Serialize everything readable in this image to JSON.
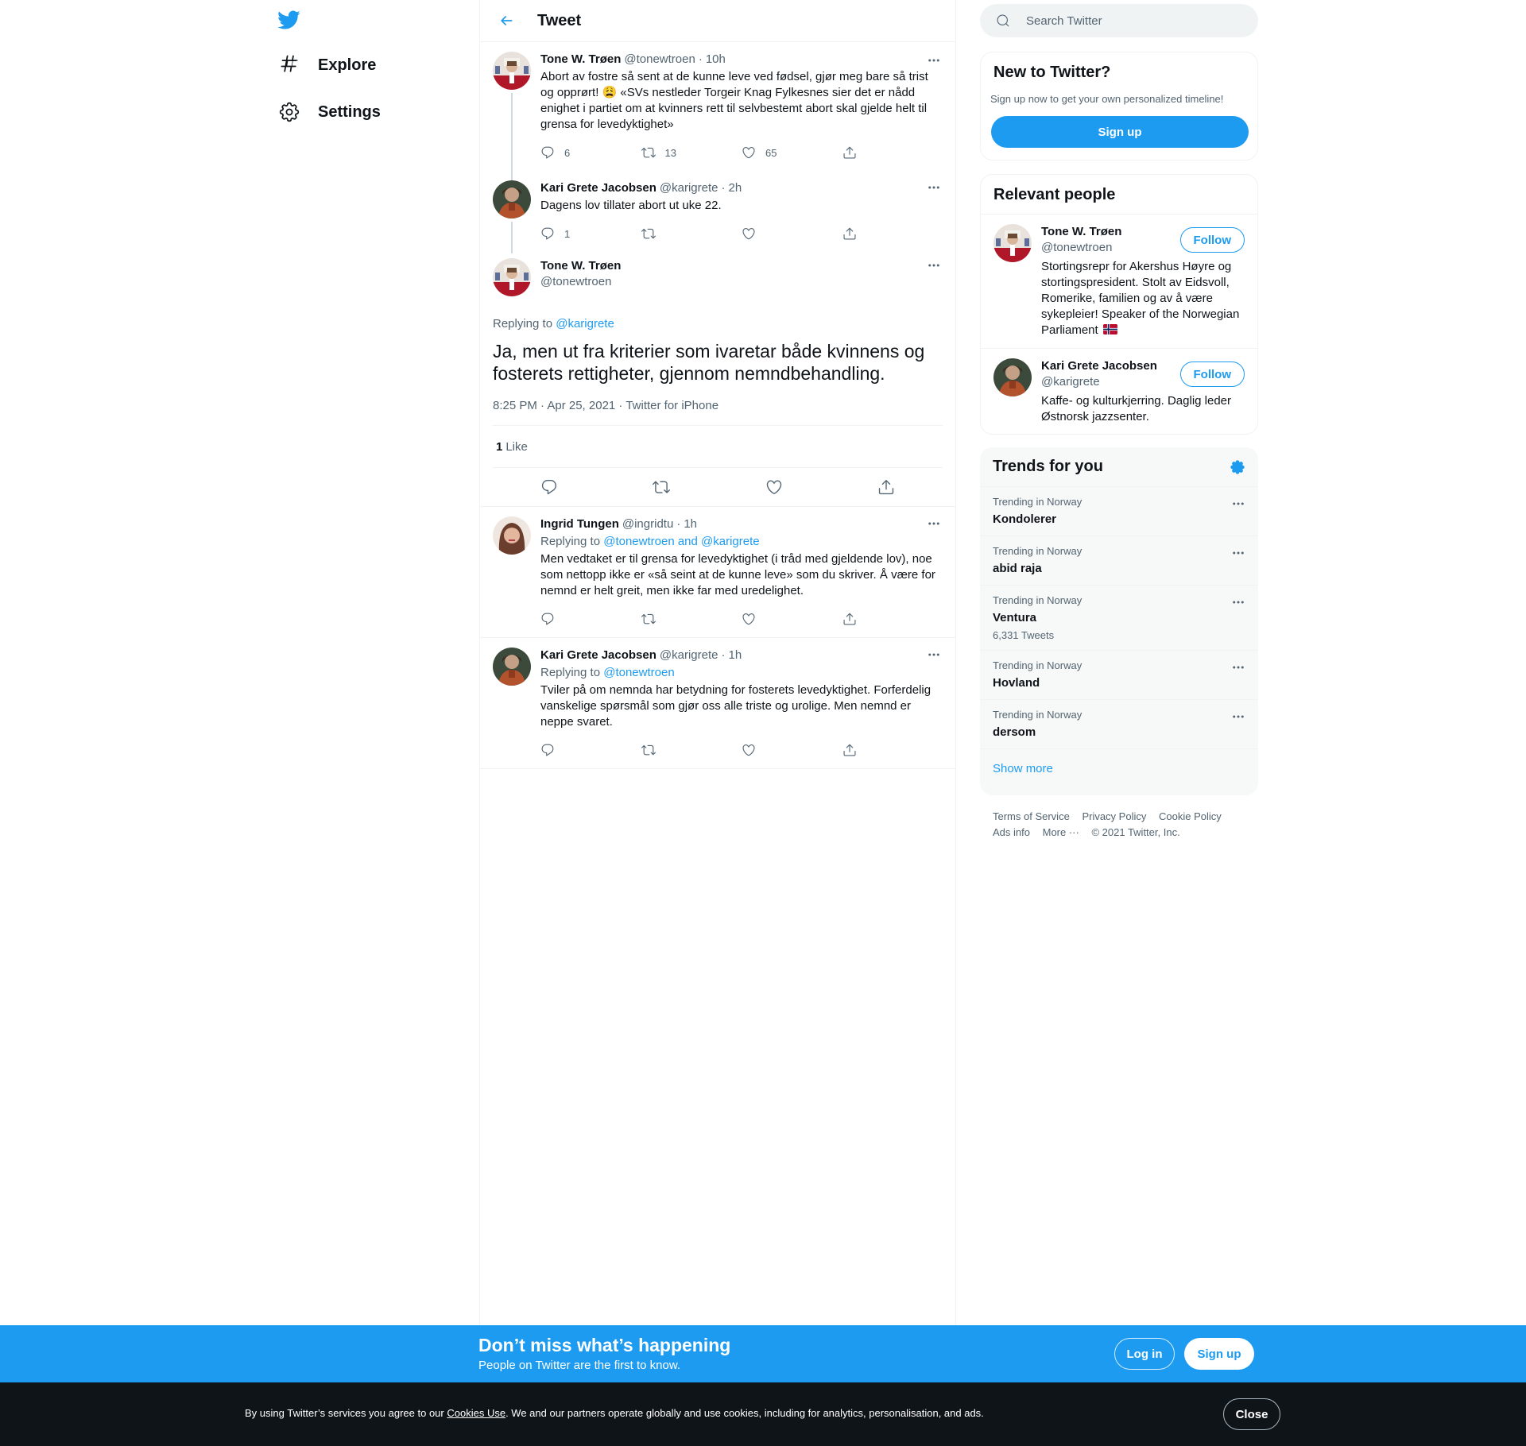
{
  "nav": {
    "items": [
      {
        "label": "Explore",
        "icon": "hashtag-icon"
      },
      {
        "label": "Settings",
        "icon": "gear-icon"
      }
    ]
  },
  "header": {
    "title": "Tweet"
  },
  "thread": [
    {
      "name": "Tone W. Trøen",
      "handle": "@tonewtroen",
      "time": "10h",
      "text": "Abort av fostre så sent at de kunne leve ved fødsel, gjør meg bare så trist og opprørt! 😩 «SVs nestleder Torgeir Knag Fylkesnes sier det er nådd enighet i partiet om at kvinners rett til selvbestemt abort skal gjelde helt til grensa for levedyktighet»",
      "replies": "6",
      "retweets": "13",
      "likes": "65"
    },
    {
      "name": "Kari Grete Jacobsen",
      "handle": "@karigrete",
      "time": "2h",
      "text": "Dagens lov tillater abort ut uke 22.",
      "replies": "1",
      "retweets": "",
      "likes": ""
    }
  ],
  "focus": {
    "name": "Tone W. Trøen",
    "handle": "@tonewtroen",
    "replying_prefix": "Replying to ",
    "replying_to": "@karigrete",
    "text": "Ja, men ut fra kriterier som ivaretar både kvinnens og fosterets rettigheter, gjennom nemndbehandling.",
    "meta_time": "8:25 PM · Apr 25, 2021",
    "meta_sep": " · ",
    "meta_source": "Twitter for iPhone",
    "likes_count": "1",
    "likes_label": "Like"
  },
  "replies": [
    {
      "name": "Ingrid Tungen",
      "handle": "@ingridtu",
      "time": "1h",
      "replying_prefix": "Replying to ",
      "replying_to": "@tonewtroen and @karigrete",
      "text": "Men vedtaket er til grensa for levedyktighet (i tråd med gjeldende lov), noe som nettopp ikke er «så seint at de kunne leve» som du skriver. Å være for nemnd er helt greit, men ikke far med uredelighet."
    },
    {
      "name": "Kari Grete Jacobsen",
      "handle": "@karigrete",
      "time": "1h",
      "replying_prefix": "Replying to ",
      "replying_to": "@tonewtroen",
      "text": "Tviler på om nemnda har betydning for fosterets levedyktighet. Forferdelig vanskelige spørsmål som gjør oss alle triste og urolige. Men nemnd er neppe svaret."
    }
  ],
  "search": {
    "placeholder": "Search Twitter"
  },
  "new_card": {
    "title": "New to Twitter?",
    "subtitle": "Sign up now to get your own personalized timeline!",
    "button": "Sign up"
  },
  "people": {
    "title": "Relevant people",
    "follow_label": "Follow",
    "items": [
      {
        "name": "Tone W. Trøen",
        "handle": "@tonewtroen",
        "bio": "Stortingsrepr for Akershus Høyre og stortingspresident. Stolt av Eidsvoll, Romerike, familien og av å være sykepleier! Speaker of the Norwegian Parliament"
      },
      {
        "name": "Kari Grete Jacobsen",
        "handle": "@karigrete",
        "bio": "Kaffe- og kulturkjerring. Daglig leder Østnorsk jazzsenter."
      }
    ]
  },
  "trends": {
    "title": "Trends for you",
    "items": [
      {
        "context": "Trending in Norway",
        "name": "Kondolerer",
        "count": ""
      },
      {
        "context": "Trending in Norway",
        "name": "abid raja",
        "count": ""
      },
      {
        "context": "Trending in Norway",
        "name": "Ventura",
        "count": "6,331 Tweets"
      },
      {
        "context": "Trending in Norway",
        "name": "Hovland",
        "count": ""
      },
      {
        "context": "Trending in Norway",
        "name": "dersom",
        "count": ""
      }
    ],
    "show_more": "Show more"
  },
  "footer": {
    "terms": "Terms of Service",
    "privacy": "Privacy Policy",
    "cookie": "Cookie Policy",
    "ads": "Ads info",
    "more": "More ···",
    "copyright": "© 2021 Twitter, Inc."
  },
  "banner": {
    "title": "Don’t miss what’s happening",
    "subtitle": "People on Twitter are the first to know.",
    "login": "Log in",
    "signup": "Sign up"
  },
  "cookie_bar": {
    "prefix": "By using Twitter’s services you agree to our ",
    "link": "Cookies Use",
    "suffix": ". We and our partners operate globally and use cookies, including for analytics, personalisation, and ads.",
    "close": "Close"
  },
  "colors": {
    "accent": "#1d9bf0",
    "text": "#0f1419",
    "secondary": "#536471",
    "cookie_bg": "#0f1419"
  }
}
